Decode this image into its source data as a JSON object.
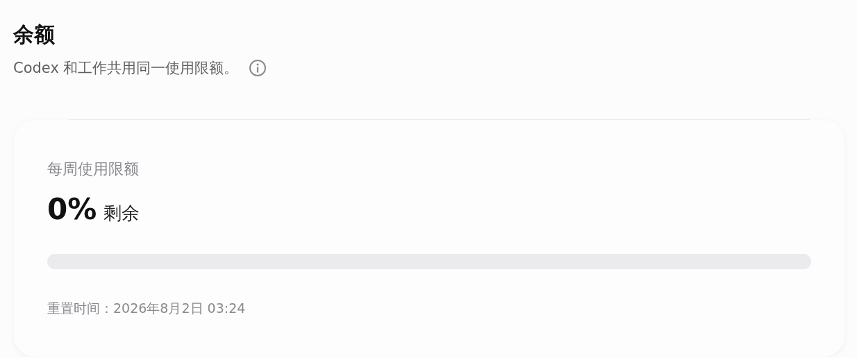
{
  "title": "余额",
  "subtitle": "Codex 和工作共用同一使用限额。",
  "card": {
    "label": "每周使用限额",
    "percent": "0%",
    "suffix": "剩余",
    "level": 0,
    "reset": "重置时间：2026年8月2日 03:24"
  }
}
